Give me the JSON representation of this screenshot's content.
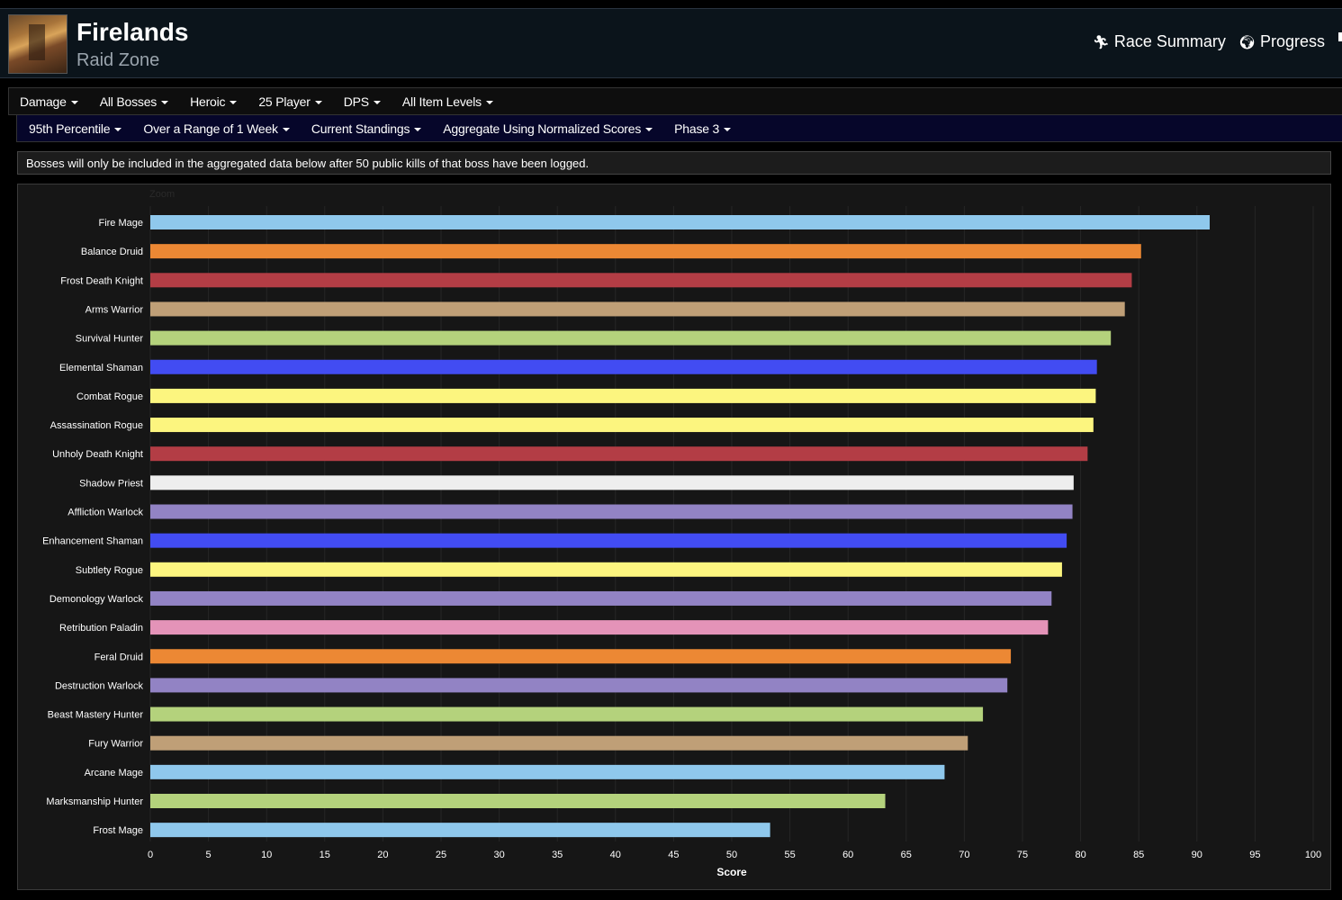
{
  "header": {
    "title": "Firelands",
    "subtitle": "Raid Zone",
    "links": [
      {
        "icon": "runner-icon",
        "label": "Race Summary"
      },
      {
        "icon": "globe-icon",
        "label": "Progress"
      }
    ]
  },
  "filters_row1": [
    "Damage",
    "All Bosses",
    "Heroic",
    "25 Player",
    "DPS",
    "All Item Levels"
  ],
  "filters_row2": [
    "95th Percentile",
    "Over a Range of 1 Week",
    "Current Standings",
    "Aggregate Using Normalized Scores",
    "Phase 3"
  ],
  "notice": "Bosses will only be included in the aggregated data below after 50 public kills of that boss have been logged.",
  "zoom_label": "Zoom",
  "chart_data": {
    "type": "bar",
    "orientation": "horizontal",
    "xlabel": "Score",
    "xlim": [
      0,
      100
    ],
    "xticks": [
      0,
      5,
      10,
      15,
      20,
      25,
      30,
      35,
      40,
      45,
      50,
      55,
      60,
      65,
      70,
      75,
      80,
      85,
      90,
      95,
      100
    ],
    "grid": true,
    "categories": [
      "Fire Mage",
      "Balance Druid",
      "Frost Death Knight",
      "Arms Warrior",
      "Survival Hunter",
      "Elemental Shaman",
      "Combat Rogue",
      "Assassination Rogue",
      "Unholy Death Knight",
      "Shadow Priest",
      "Affliction Warlock",
      "Enhancement Shaman",
      "Subtlety Rogue",
      "Demonology Warlock",
      "Retribution Paladin",
      "Feral Druid",
      "Destruction Warlock",
      "Beast Mastery Hunter",
      "Fury Warrior",
      "Arcane Mage",
      "Marksmanship Hunter",
      "Frost Mage"
    ],
    "values": [
      91.1,
      85.2,
      84.4,
      83.8,
      82.6,
      81.4,
      81.3,
      81.1,
      80.6,
      79.4,
      79.3,
      78.8,
      78.4,
      77.5,
      77.2,
      74.0,
      73.7,
      71.6,
      70.3,
      68.3,
      63.2,
      53.3
    ],
    "colors": [
      "#8fc8ec",
      "#ec8834",
      "#b33d45",
      "#bf9f77",
      "#b4d27c",
      "#424cf2",
      "#fcf57f",
      "#fcf57f",
      "#b33d45",
      "#eeeeee",
      "#9283c4",
      "#424cf2",
      "#fcf57f",
      "#9283c4",
      "#e493b8",
      "#ec8834",
      "#9283c4",
      "#b4d27c",
      "#bf9f77",
      "#8fc8ec",
      "#b4d27c",
      "#8fc8ec"
    ]
  }
}
